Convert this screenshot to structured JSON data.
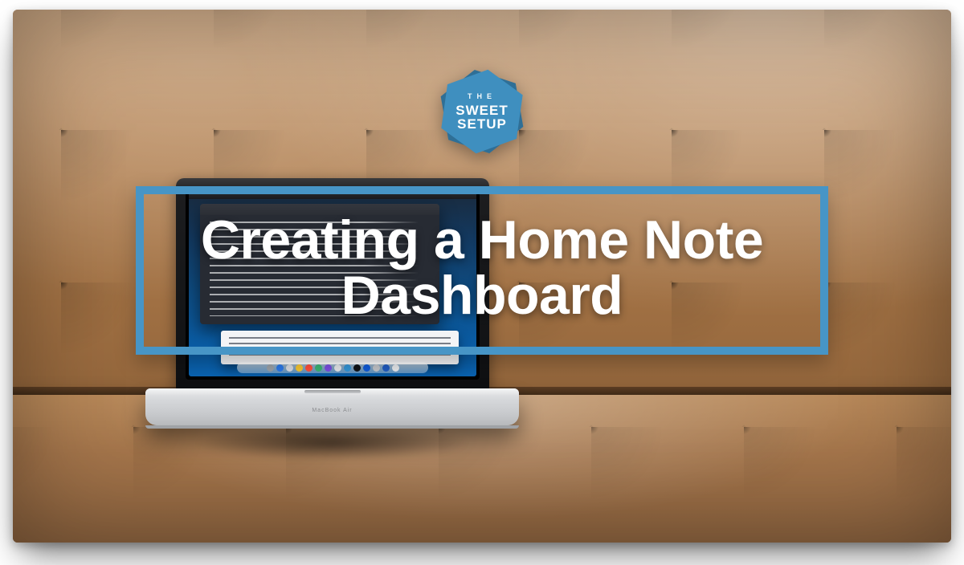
{
  "brand": {
    "line1": "THE",
    "line2": "SWEET",
    "line3": "SETUP"
  },
  "title": "Creating a Home Note\nDashboard",
  "laptop_brand": "MacBook Air",
  "colors": {
    "accent": "#4795c6",
    "badge_front": "#3f8fbf",
    "badge_back": "#2f6f96"
  },
  "dock_icons": [
    "#9aa0a6",
    "#2b77e6",
    "#d8dadf",
    "#f4c430",
    "#ff4e3a",
    "#3bb273",
    "#7a4de0",
    "#e3e5e8",
    "#3293d4",
    "#111317",
    "#0f5ad6",
    "#c1c3c7",
    "#205bbf",
    "#e6e8eb"
  ]
}
